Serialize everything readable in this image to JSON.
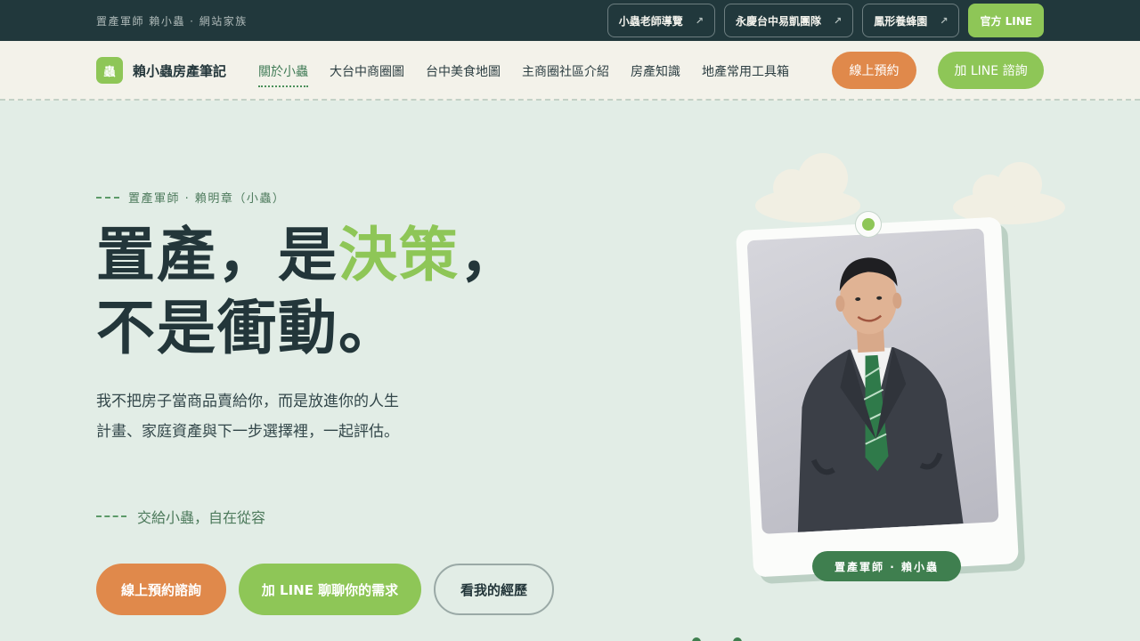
{
  "topbar": {
    "tagline": "置產軍師 賴小蟲 · 網站家族",
    "links": [
      {
        "label": "小蟲老師導覽",
        "arrow": "↗"
      },
      {
        "label": "永慶台中易凱團隊",
        "arrow": "↗"
      },
      {
        "label": "鳳形養蜂園",
        "arrow": "↗"
      }
    ],
    "line_label": "官方 LINE"
  },
  "nav": {
    "brand_mark": "蟲",
    "brand_name": "賴小蟲房產筆記",
    "items": [
      {
        "label": "關於小蟲",
        "active": true
      },
      {
        "label": "大台中商圈圖"
      },
      {
        "label": "台中美食地圖"
      },
      {
        "label": "主商圈社區介紹"
      },
      {
        "label": "房產知識"
      },
      {
        "label": "地產常用工具箱"
      }
    ],
    "book_label": "線上預約",
    "line_label": "加 LINE 諮詢"
  },
  "hero": {
    "eyebrow": "置產軍師 · 賴明章（小蟲）",
    "headline_part1": "置產，是",
    "headline_highlight": "決策",
    "headline_part2": "，",
    "headline_line2": "不是衝動。",
    "description": "我不把房子當商品賣給你，而是放進你的人生計畫、家庭資產與下一步選擇裡，一起評估。",
    "tagline": "交給小蟲，自在從容",
    "cta_book": "線上預約諮詢",
    "cta_line": "加 LINE 聊聊你的需求",
    "cta_experience": "看我的經歷",
    "photo_caption": "置產軍師 · 賴小蟲"
  },
  "colors": {
    "accent_green": "#8ec657",
    "accent_orange": "#e0894b",
    "dark": "#21383c",
    "hero_bg": "#e2ede6"
  }
}
